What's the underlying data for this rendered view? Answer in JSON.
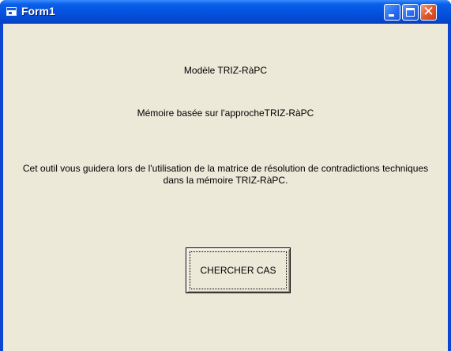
{
  "window": {
    "title": "Form1",
    "icon": "form-icon",
    "controls": {
      "minimize_icon": "minimize-icon",
      "maximize_icon": "maximize-icon",
      "close_icon": "close-icon",
      "close_glyph": "✕"
    },
    "colors": {
      "titlebar": "#0553e0",
      "client": "#ece9d8",
      "close": "#e0582e"
    }
  },
  "form": {
    "model_label": "Modèle TRIZ-RàPC",
    "memory_label": "Mémoire basée sur l'approcheTRIZ-RàPC",
    "description": "Cet outil vous guidera lors de l'utilisation de la matrice de résolution de contradictions techniques dans la mémoire TRIZ-RàPC.",
    "search_button": "CHERCHER CAS"
  }
}
